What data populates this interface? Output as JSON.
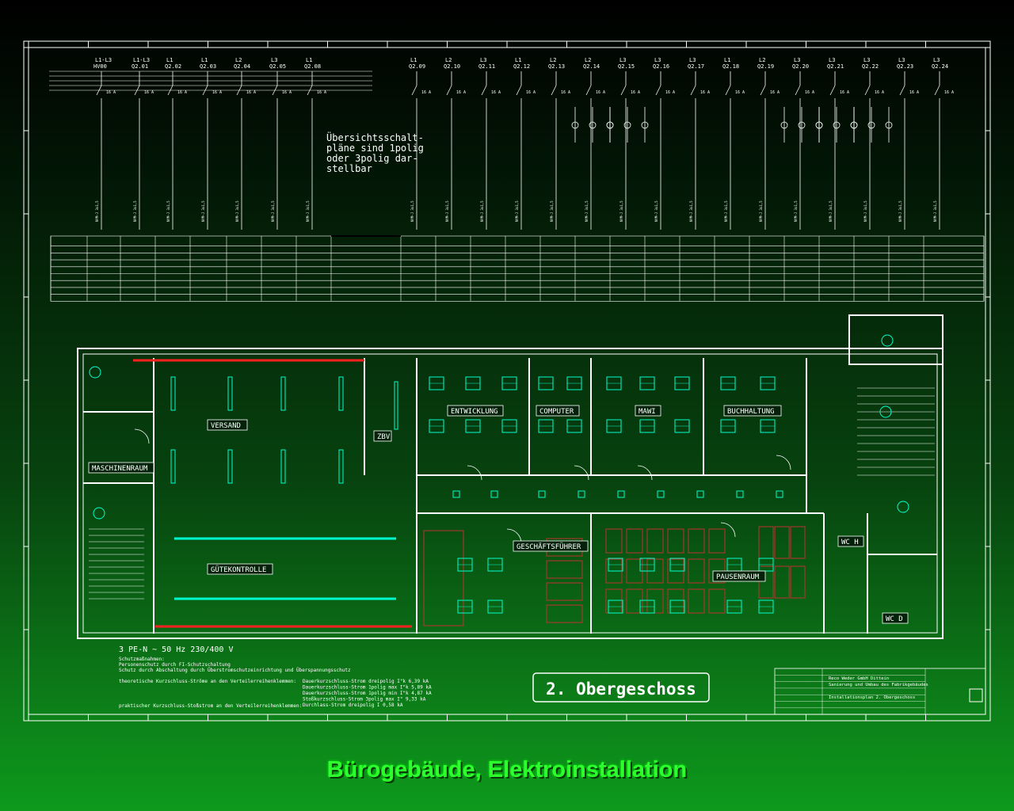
{
  "caption": "Bürogebäude, Elektroinstallation",
  "plan_title": "2. Obergeschoss",
  "note": [
    "Übersichtsschalt-",
    "pläne sind 1polig",
    "oder 3polig dar-",
    "stellbar"
  ],
  "supply": "3 PE-N ~ 50 Hz 230/400 V",
  "protection": [
    "Schutzmaßnahmen:",
    "Personenschutz durch FI-Schutzschaltung",
    "Schutz durch Abschaltung durch Überstromschutzeinrichtung und Überspannungsschutz"
  ],
  "shortcircuit": {
    "left": [
      "theoretische Kurzschluss-Ströme an den Verteilerreihenklemmen:",
      "praktischer Kurzschluss-Stoßstrom an den Verteilerreihenklemmen:"
    ],
    "rows": [
      "Dauerkurzschluss-Strom  dreipolig I\"k  6,39 kA",
      "Dauerkurzschluss-Strom 1polig max I\"k  5,89 kA",
      "Dauerkurzschluss-Strom 1polig min I\"k  4,87 kA",
      "Stoßkurzschluss-Strom  3polig max I\"  9,33 kA",
      "Durchlass-Strom        dreipolig I    0,58 kA"
    ]
  },
  "circuits": [
    {
      "phase": "L1-L3",
      "id": "HV00"
    },
    {
      "phase": "L1-L3",
      "id": "Q2.01"
    },
    {
      "phase": "L1",
      "id": "Q2.02"
    },
    {
      "phase": "L1",
      "id": "Q2.03"
    },
    {
      "phase": "L2",
      "id": "Q2.04"
    },
    {
      "phase": "L3",
      "id": "Q2.05"
    },
    {
      "phase": "L1",
      "id": "Q2.08"
    },
    {
      "phase": "L1",
      "id": "Q2.09"
    },
    {
      "phase": "L2",
      "id": "Q2.10"
    },
    {
      "phase": "L3",
      "id": "Q2.11"
    },
    {
      "phase": "L1",
      "id": "Q2.12"
    },
    {
      "phase": "L2",
      "id": "Q2.13"
    },
    {
      "phase": "L2",
      "id": "Q2.14"
    },
    {
      "phase": "L3",
      "id": "Q2.15"
    },
    {
      "phase": "L3",
      "id": "Q2.16"
    },
    {
      "phase": "L3",
      "id": "Q2.17"
    },
    {
      "phase": "L1",
      "id": "Q2.18"
    },
    {
      "phase": "L2",
      "id": "Q2.19"
    },
    {
      "phase": "L3",
      "id": "Q2.20"
    },
    {
      "phase": "L3",
      "id": "Q2.21"
    },
    {
      "phase": "L3",
      "id": "Q2.22"
    },
    {
      "phase": "L3",
      "id": "Q2.23"
    },
    {
      "phase": "L3",
      "id": "Q2.24"
    }
  ],
  "rooms": {
    "versand": "VERSAND",
    "maschinenraum": "MASCHINENRAUM",
    "zbv": "ZBV",
    "entwicklung": "ENTWICKLUNG",
    "computer": "COMPUTER",
    "mawi": "MAWI",
    "buchhaltung": "BUCHHALTUNG",
    "guetekontrolle": "GÜTEKONTROLLE",
    "geschaeftsfuehrer": "GESCHÄFTSFÜHRER",
    "pausenraum": "PAUSENRAUM",
    "wc_h": "WC H",
    "wc_d": "WC D"
  },
  "colors": {
    "lines": "#ffffff",
    "fixtures": "#00ffd0",
    "accent_red": "#ff2020",
    "furniture": "#c03030",
    "caption": "#2eff2e"
  },
  "titleblock": {
    "company": "Reco Weder GmbH Dittein",
    "project": "Sanierung und Umbau des Fabrikgebäudes",
    "drawing": "Installationsplan 2. Obergeschoss"
  },
  "icons": [
    "breaker-icon",
    "lamp-icon",
    "socket-icon",
    "switch-icon"
  ]
}
